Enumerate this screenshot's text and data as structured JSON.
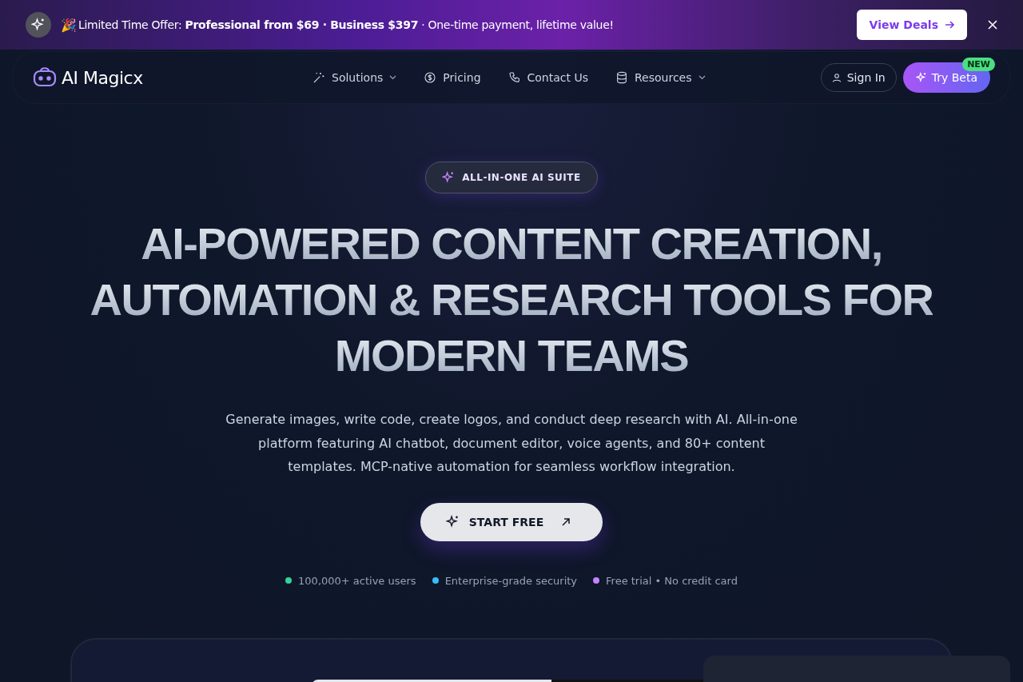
{
  "promo_bar": {
    "emoji": "🎉",
    "message": "Limited Time Offer: **Professional from $69 · Business $397** · One-time payment, lifetime value!",
    "button": "View Deals"
  },
  "nav": {
    "logo": "AI Magicx",
    "items": [
      {
        "label": "Solutions",
        "dropdown": true
      },
      {
        "label": "Pricing",
        "dropdown": false
      },
      {
        "label": "Contact Us",
        "dropdown": false
      },
      {
        "label": "Resources",
        "dropdown": true
      }
    ],
    "sign_in": "Sign In",
    "try_beta": "Try Beta",
    "beta_badge": "NEW"
  },
  "hero": {
    "pill": "ALL-IN-ONE AI SUITE",
    "heading_lines": [
      "AI-POWERED CONTENT CREATION,",
      "AUTOMATION & RESEARCH TOOLS FOR",
      "MODERN TEAMS"
    ],
    "description": "Generate images, write code, create logos, and conduct deep research with AI. All-in-one platform featuring AI chatbot, document editor, voice agents, and 80+ content templates. MCP-native automation for seamless workflow integration.",
    "cta": "START FREE",
    "features": [
      {
        "label": "100,000+ active users",
        "color": "#34d399"
      },
      {
        "label": "Enterprise-grade security",
        "color": "#38bdf8"
      },
      {
        "label": "Free trial • No credit card",
        "color": "#c084fc"
      }
    ]
  }
}
